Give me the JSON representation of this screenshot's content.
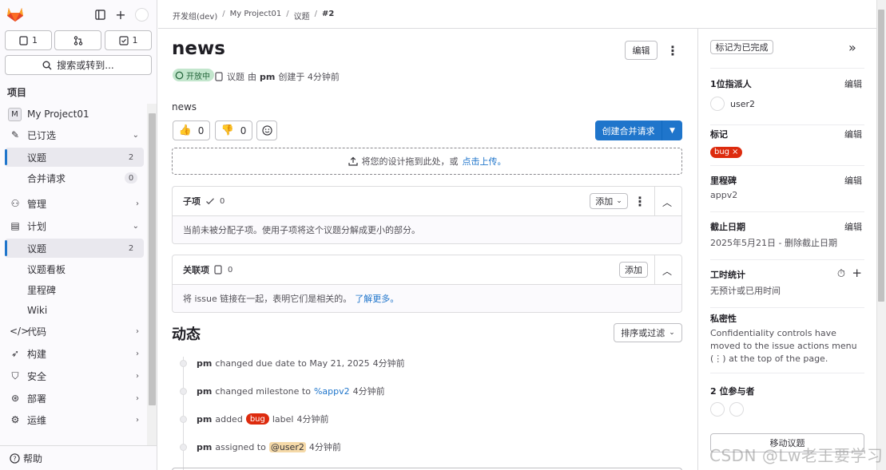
{
  "sidebar": {
    "counters": [
      {
        "icon": "issue-icon",
        "value": "1"
      },
      {
        "icon": "merge-request-icon",
        "value": ""
      },
      {
        "icon": "todo-icon",
        "value": "1"
      }
    ],
    "search_label": "搜索或转到...",
    "section_label": "项目",
    "project_avatar": "M",
    "project_name": "My Project01",
    "pinned_label": "已订选",
    "pinned": [
      {
        "label": "议题",
        "count": "2"
      },
      {
        "label": "合并请求",
        "count": "0"
      }
    ],
    "manage_label": "管理",
    "plan_label": "计划",
    "plan_items": [
      {
        "label": "议题",
        "count": "2"
      },
      {
        "label": "议题看板"
      },
      {
        "label": "里程碑"
      },
      {
        "label": "Wiki"
      }
    ],
    "code_label": "代码",
    "build_label": "构建",
    "secure_label": "安全",
    "deploy_label": "部署",
    "operate_label": "运维",
    "help_label": "帮助"
  },
  "breadcrumb": [
    "开发组(dev)",
    "My Project01",
    "议题",
    "#2"
  ],
  "issue": {
    "title": "news",
    "edit_label": "编辑",
    "status": "开放中",
    "meta_type": "议题",
    "meta_by": "由",
    "meta_author": "pm",
    "meta_created": "创建于 4分钟前",
    "description": "news",
    "thumbs_up": "0",
    "thumbs_down": "0",
    "create_mr_label": "创建合并请求",
    "dropzone_text": "将您的设计拖到此处，或",
    "dropzone_link": "点击上传。"
  },
  "child_items": {
    "title": "子项",
    "count": "0",
    "add_label": "添加",
    "empty_text": "当前未被分配子项。使用子项将这个议题分解成更小的部分。"
  },
  "linked_items": {
    "title": "关联项",
    "count": "0",
    "add_label": "添加",
    "empty_text": "将 issue 链接在一起，表明它们是相关的。",
    "learn_more": "了解更多。"
  },
  "activity": {
    "title": "动态",
    "sort_label": "排序或过滤",
    "notes": [
      {
        "author": "pm",
        "pre": "changed due date to May 21, 2025",
        "time": "4分钟前"
      },
      {
        "author": "pm",
        "pre": "changed milestone to",
        "link": "%appv2",
        "time": "4分钟前"
      },
      {
        "author": "pm",
        "pre": "added",
        "label": "bug",
        "post": "label",
        "time": "4分钟前"
      },
      {
        "author": "pm",
        "pre": "assigned to",
        "mention": "@user2",
        "time": "4分钟前"
      }
    ]
  },
  "right_sidebar": {
    "mark_done": "标记为已完成",
    "assignee_title": "1位指派人",
    "assignee_name": "user2",
    "labels_title": "标记",
    "label_bug": "bug",
    "milestone_title": "里程碑",
    "milestone_value": "appv2",
    "due_title": "截止日期",
    "due_value": "2025年5月21日 -",
    "due_remove": "删除截止日期",
    "time_title": "工时统计",
    "time_value": "无预计或已用时间",
    "conf_title": "私密性",
    "conf_text": "Confidentiality controls have moved to the issue actions menu (⋮) at the top of the page.",
    "participants_title": "2 位参与者",
    "move_label": "移动议题",
    "edit_label": "编辑"
  },
  "watermark": "CSDN @Lw老王要学习",
  "colors": {
    "accent": "#1f75cb",
    "bug": "#dd2b0e",
    "status_bg": "#c3e6cd",
    "status_fg": "#24663b"
  }
}
